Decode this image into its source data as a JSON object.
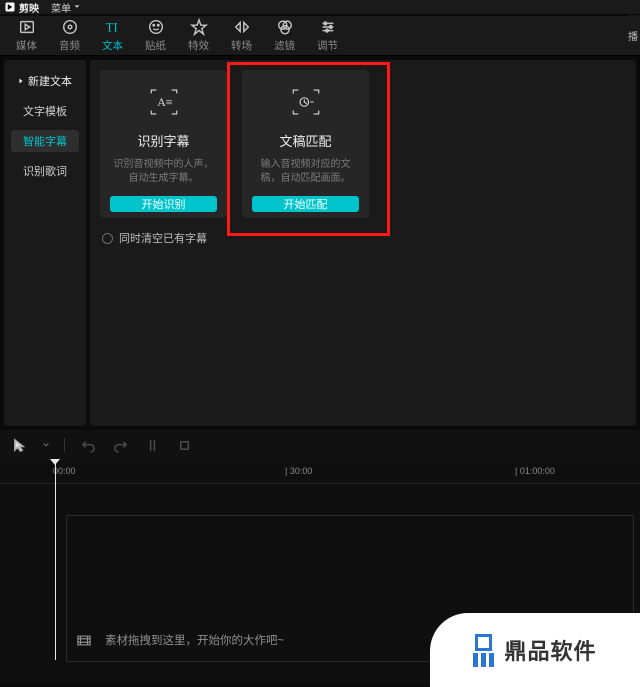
{
  "titlebar": {
    "app_name": "剪映",
    "menu_label": "菜单"
  },
  "tabs": {
    "media": "媒体",
    "audio": "音频",
    "text": "文本",
    "sticker": "贴纸",
    "effect": "特效",
    "transition": "转场",
    "filter": "滤镜",
    "adjust": "调节",
    "right_stub": "播"
  },
  "sidebar": {
    "new_text": "新建文本",
    "template": "文字模板",
    "smart_subtitle": "智能字幕",
    "recognize_lyrics": "识别歌词"
  },
  "cards": {
    "recognize": {
      "title": "识别字幕",
      "desc": "识别音视频中的人声，自动生成字幕。",
      "button": "开始识别"
    },
    "match": {
      "title": "文稿匹配",
      "desc": "输入音视频对应的文稿，自动匹配画面。",
      "button": "开始匹配"
    }
  },
  "checkbox_label": "同时清空已有字幕",
  "timeline": {
    "t0": "00:00",
    "t1": "| 30:00",
    "t2": "| 01:00:00",
    "hint": "素材拖拽到这里，开始你的大作吧~"
  },
  "watermark": "鼎品软件"
}
